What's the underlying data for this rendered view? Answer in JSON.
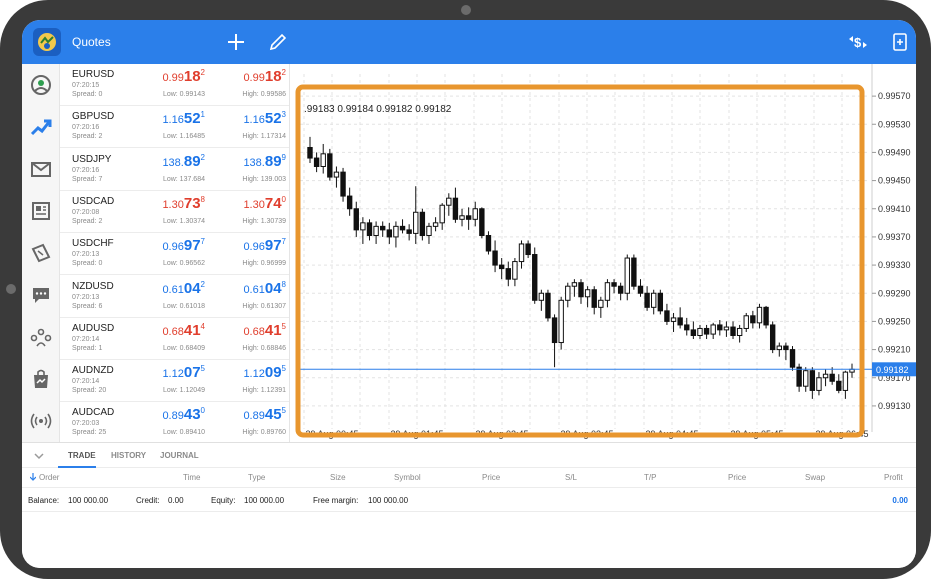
{
  "header": {
    "title": "Quotes"
  },
  "quotes": [
    {
      "symbol": "EURUSD",
      "time": "07:20:15",
      "spread": "Spread: 0",
      "dir": "red",
      "bid": {
        "pre": "0.99",
        "big": "18",
        "sup": "2"
      },
      "ask": {
        "pre": "0.99",
        "big": "18",
        "sup": "2"
      },
      "low": "Low: 0.99143",
      "high": "High: 0.99586"
    },
    {
      "symbol": "GBPUSD",
      "time": "07:20:16",
      "spread": "Spread: 2",
      "dir": "blue",
      "bid": {
        "pre": "1.16",
        "big": "52",
        "sup": "1"
      },
      "ask": {
        "pre": "1.16",
        "big": "52",
        "sup": "3"
      },
      "low": "Low: 1.16485",
      "high": "High: 1.17314"
    },
    {
      "symbol": "USDJPY",
      "time": "07:20:16",
      "spread": "Spread: 7",
      "dir": "blue",
      "bid": {
        "pre": "138.",
        "big": "89",
        "sup": "2"
      },
      "ask": {
        "pre": "138.",
        "big": "89",
        "sup": "9"
      },
      "low": "Low: 137.684",
      "high": "High: 139.003"
    },
    {
      "symbol": "USDCAD",
      "time": "07:20:08",
      "spread": "Spread: 2",
      "dir": "red",
      "bid": {
        "pre": "1.30",
        "big": "73",
        "sup": "8"
      },
      "ask": {
        "pre": "1.30",
        "big": "74",
        "sup": "0"
      },
      "low": "Low: 1.30374",
      "high": "High: 1.30739"
    },
    {
      "symbol": "USDCHF",
      "time": "07:20:13",
      "spread": "Spread: 0",
      "dir": "blue",
      "bid": {
        "pre": "0.96",
        "big": "97",
        "sup": "7"
      },
      "ask": {
        "pre": "0.96",
        "big": "97",
        "sup": "7"
      },
      "low": "Low: 0.96562",
      "high": "High: 0.96999"
    },
    {
      "symbol": "NZDUSD",
      "time": "07:20:13",
      "spread": "Spread: 6",
      "dir": "blue",
      "bid": {
        "pre": "0.61",
        "big": "04",
        "sup": "2"
      },
      "ask": {
        "pre": "0.61",
        "big": "04",
        "sup": "8"
      },
      "low": "Low: 0.61018",
      "high": "High: 0.61307"
    },
    {
      "symbol": "AUDUSD",
      "time": "07:20:14",
      "spread": "Spread: 1",
      "dir": "red",
      "bid": {
        "pre": "0.68",
        "big": "41",
        "sup": "4"
      },
      "ask": {
        "pre": "0.68",
        "big": "41",
        "sup": "5"
      },
      "low": "Low: 0.68409",
      "high": "High: 0.68846"
    },
    {
      "symbol": "AUDNZD",
      "time": "07:20:14",
      "spread": "Spread: 20",
      "dir": "blue",
      "bid": {
        "pre": "1.12",
        "big": "07",
        "sup": "5"
      },
      "ask": {
        "pre": "1.12",
        "big": "09",
        "sup": "5"
      },
      "low": "Low: 1.12049",
      "high": "High: 1.12391"
    },
    {
      "symbol": "AUDCAD",
      "time": "07:20:03",
      "spread": "Spread: 25",
      "dir": "blue",
      "bid": {
        "pre": "0.89",
        "big": "43",
        "sup": "0"
      },
      "ask": {
        "pre": "0.89",
        "big": "45",
        "sup": "5"
      },
      "low": "Low: 0.89410",
      "high": "High: 0.89760"
    }
  ],
  "chart": {
    "ohlc_label": ".99183 0.99184 0.99182 0.99182",
    "price_label": "0.99182",
    "highlight_color": "#e8962e"
  },
  "chart_data": {
    "type": "candlestick",
    "y_ticks": [
      "0.99570",
      "0.99530",
      "0.99490",
      "0.99450",
      "0.99410",
      "0.99370",
      "0.99330",
      "0.99290",
      "0.99250",
      "0.99210",
      "0.99170",
      "0.99130"
    ],
    "x_ticks": [
      "29 Aug 00:45",
      "29 Aug 01:45",
      "29 Aug 02:45",
      "29 Aug 03:45",
      "29 Aug 04:45",
      "29 Aug 05:45",
      "29 Aug 06:45"
    ],
    "ylim": [
      0.9911,
      0.9959
    ],
    "current_price": 0.99182,
    "candles": [
      [
        0.99497,
        0.99512,
        0.99475,
        0.99482
      ],
      [
        0.99482,
        0.9949,
        0.99462,
        0.9947
      ],
      [
        0.9947,
        0.99502,
        0.9946,
        0.99488
      ],
      [
        0.99488,
        0.99495,
        0.9945,
        0.99455
      ],
      [
        0.99455,
        0.9947,
        0.9944,
        0.99462
      ],
      [
        0.99462,
        0.99468,
        0.9942,
        0.99428
      ],
      [
        0.99428,
        0.9944,
        0.994,
        0.9941
      ],
      [
        0.9941,
        0.9942,
        0.9937,
        0.9938
      ],
      [
        0.9938,
        0.99398,
        0.9936,
        0.9939
      ],
      [
        0.9939,
        0.99395,
        0.99365,
        0.99372
      ],
      [
        0.99372,
        0.99392,
        0.9936,
        0.99385
      ],
      [
        0.99385,
        0.99392,
        0.9937,
        0.9938
      ],
      [
        0.9938,
        0.9939,
        0.9936,
        0.9937
      ],
      [
        0.9937,
        0.99392,
        0.99355,
        0.99385
      ],
      [
        0.99385,
        0.99395,
        0.99375,
        0.9938
      ],
      [
        0.9938,
        0.99388,
        0.99365,
        0.99375
      ],
      [
        0.99375,
        0.99442,
        0.9936,
        0.99405
      ],
      [
        0.99405,
        0.9941,
        0.99365,
        0.99372
      ],
      [
        0.99372,
        0.9939,
        0.9936,
        0.99385
      ],
      [
        0.99385,
        0.99398,
        0.99378,
        0.9939
      ],
      [
        0.9939,
        0.99418,
        0.9938,
        0.99415
      ],
      [
        0.99415,
        0.99432,
        0.994,
        0.99425
      ],
      [
        0.99425,
        0.9944,
        0.9939,
        0.99395
      ],
      [
        0.99395,
        0.9941,
        0.99385,
        0.994
      ],
      [
        0.994,
        0.99412,
        0.9938,
        0.99395
      ],
      [
        0.99395,
        0.9942,
        0.99385,
        0.9941
      ],
      [
        0.9941,
        0.99412,
        0.99368,
        0.99372
      ],
      [
        0.99372,
        0.99378,
        0.99345,
        0.9935
      ],
      [
        0.9935,
        0.99365,
        0.9932,
        0.9933
      ],
      [
        0.9933,
        0.9934,
        0.9931,
        0.99325
      ],
      [
        0.99325,
        0.99335,
        0.993,
        0.9931
      ],
      [
        0.9931,
        0.9934,
        0.993,
        0.99335
      ],
      [
        0.99335,
        0.99365,
        0.99325,
        0.9936
      ],
      [
        0.9936,
        0.99365,
        0.9934,
        0.99345
      ],
      [
        0.99345,
        0.99355,
        0.99275,
        0.9928
      ],
      [
        0.9928,
        0.99295,
        0.99265,
        0.9929
      ],
      [
        0.9929,
        0.99295,
        0.9925,
        0.99255
      ],
      [
        0.99255,
        0.9926,
        0.99185,
        0.9922
      ],
      [
        0.9922,
        0.99285,
        0.9921,
        0.9928
      ],
      [
        0.9928,
        0.99305,
        0.9927,
        0.993
      ],
      [
        0.993,
        0.9931,
        0.99285,
        0.99305
      ],
      [
        0.99305,
        0.9931,
        0.99275,
        0.99285
      ],
      [
        0.99285,
        0.993,
        0.9927,
        0.99295
      ],
      [
        0.99295,
        0.993,
        0.9926,
        0.9927
      ],
      [
        0.9927,
        0.99285,
        0.99255,
        0.9928
      ],
      [
        0.9928,
        0.9931,
        0.9927,
        0.99305
      ],
      [
        0.99305,
        0.9931,
        0.9929,
        0.993
      ],
      [
        0.993,
        0.99305,
        0.9928,
        0.9929
      ],
      [
        0.9929,
        0.99345,
        0.9928,
        0.9934
      ],
      [
        0.9934,
        0.99345,
        0.99295,
        0.993
      ],
      [
        0.993,
        0.9931,
        0.99285,
        0.9929
      ],
      [
        0.9929,
        0.993,
        0.99265,
        0.9927
      ],
      [
        0.9927,
        0.99295,
        0.9926,
        0.9929
      ],
      [
        0.9929,
        0.99295,
        0.9926,
        0.99265
      ],
      [
        0.99265,
        0.99275,
        0.99245,
        0.9925
      ],
      [
        0.9925,
        0.99262,
        0.99235,
        0.99255
      ],
      [
        0.99255,
        0.9927,
        0.9924,
        0.99245
      ],
      [
        0.99245,
        0.99255,
        0.9923,
        0.99238
      ],
      [
        0.99238,
        0.9925,
        0.99225,
        0.9923
      ],
      [
        0.9923,
        0.99245,
        0.99225,
        0.9924
      ],
      [
        0.9924,
        0.99245,
        0.99225,
        0.99232
      ],
      [
        0.99232,
        0.99248,
        0.99225,
        0.99245
      ],
      [
        0.99245,
        0.99252,
        0.9923,
        0.99238
      ],
      [
        0.99238,
        0.9925,
        0.99228,
        0.99242
      ],
      [
        0.99242,
        0.9925,
        0.99225,
        0.9923
      ],
      [
        0.9923,
        0.99245,
        0.9922,
        0.9924
      ],
      [
        0.9924,
        0.99262,
        0.99235,
        0.99258
      ],
      [
        0.99258,
        0.99265,
        0.9924,
        0.99248
      ],
      [
        0.99248,
        0.99275,
        0.9924,
        0.9927
      ],
      [
        0.9927,
        0.99272,
        0.9924,
        0.99245
      ],
      [
        0.99245,
        0.9925,
        0.99205,
        0.9921
      ],
      [
        0.9921,
        0.9922,
        0.992,
        0.99215
      ],
      [
        0.99215,
        0.9922,
        0.99195,
        0.9921
      ],
      [
        0.9921,
        0.99215,
        0.9918,
        0.99185
      ],
      [
        0.99185,
        0.9919,
        0.9915,
        0.99158
      ],
      [
        0.99158,
        0.99185,
        0.9915,
        0.9918
      ],
      [
        0.9918,
        0.99185,
        0.9914,
        0.99152
      ],
      [
        0.99152,
        0.99178,
        0.99145,
        0.9917
      ],
      [
        0.9917,
        0.99182,
        0.99158,
        0.99175
      ],
      [
        0.99175,
        0.99185,
        0.9916,
        0.99165
      ],
      [
        0.99165,
        0.99175,
        0.99148,
        0.99152
      ],
      [
        0.99152,
        0.9918,
        0.9914,
        0.99178
      ],
      [
        0.99178,
        0.9919,
        0.9917,
        0.99182
      ]
    ]
  },
  "bottom": {
    "tabs": [
      "TRADE",
      "HISTORY",
      "JOURNAL"
    ],
    "columns": {
      "order": "Order",
      "time": "Time",
      "type": "Type",
      "size": "Size",
      "symbol": "Symbol",
      "price": "Price",
      "sl": "S/L",
      "tp": "T/P",
      "price2": "Price",
      "swap": "Swap",
      "profit": "Profit"
    },
    "balance_label": "Balance:",
    "balance_value": "100 000.00",
    "credit_label": "Credit:",
    "credit_value": "0.00",
    "equity_label": "Equity:",
    "equity_value": "100 000.00",
    "free_margin_label": "Free margin:",
    "free_margin_value": "100 000.00",
    "profit_total": "0.00"
  },
  "icons": {
    "logo": "metatrader-logo-icon",
    "add": "plus-icon",
    "edit": "pencil-icon",
    "symbol_switch": "currency-switch-icon",
    "new_order": "new-order-icon",
    "nav": [
      "quotes-icon",
      "chart-icon",
      "mail-icon",
      "news-icon",
      "trade-icon",
      "chat-icon",
      "community-icon",
      "market-icon",
      "signal-icon"
    ]
  }
}
